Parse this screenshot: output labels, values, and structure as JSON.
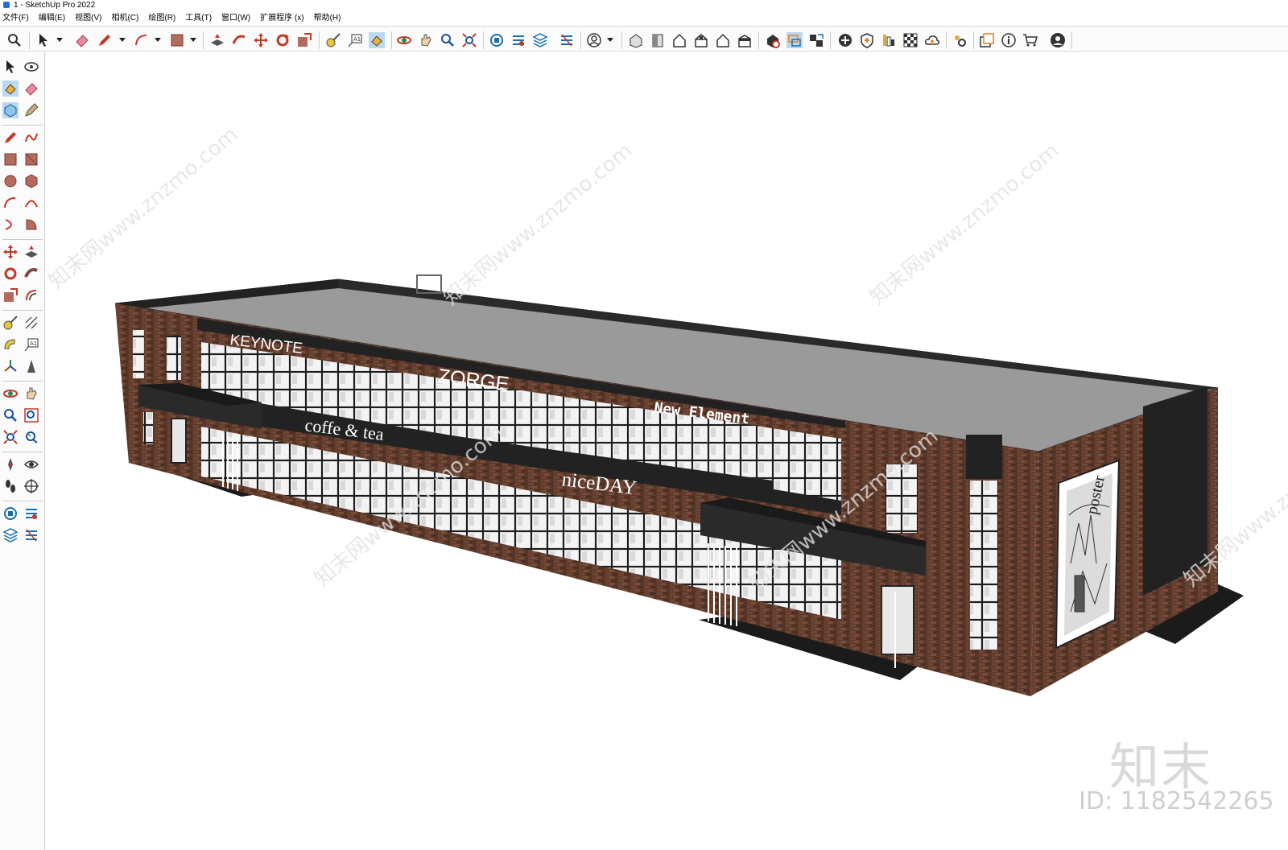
{
  "window": {
    "title": "1 - SketchUp Pro 2022"
  },
  "menu": {
    "items": [
      "文件(F)",
      "编辑(E)",
      "视图(V)",
      "相机(C)",
      "绘图(R)",
      "工具(T)",
      "窗口(W)",
      "扩展程序 (x)",
      "帮助(H)"
    ]
  },
  "toolbar": {
    "icons": [
      "search-icon",
      "select-icon",
      "eraser-icon",
      "pencil-icon",
      "arc-icon",
      "rectangle-icon",
      "push-pull-icon",
      "follow-me-icon",
      "move-icon",
      "rotate-icon",
      "scale-icon",
      "tape-measure-icon",
      "text-icon",
      "paint-bucket-icon",
      "orbit-icon",
      "pan-icon",
      "zoom-icon",
      "zoom-extents-icon",
      "warehouse-icon",
      "extension-warehouse-icon",
      "layout-icon",
      "styles-icon",
      "user-icon",
      "iso-view-icon",
      "top-view-icon",
      "front-view-icon",
      "right-view-icon",
      "back-view-icon",
      "left-view-icon",
      "solid-tools-icon",
      "section-plane-icon",
      "scenes-icon",
      "add-location-icon",
      "sandbox-icon",
      "dynamic-components-icon",
      "checkerboard-icon",
      "cloud-icon",
      "settings-icon",
      "outliner-icon",
      "info-icon",
      "cart-icon",
      "account-icon"
    ]
  },
  "left_toolbar": {
    "icons": [
      "select-icon",
      "orbit-icon",
      "paint-bucket-icon",
      "eraser-icon",
      "component-icon",
      "tag-icon",
      "pencil-icon",
      "freehand-icon",
      "rectangle-icon",
      "rotated-rectangle-icon",
      "circle-icon",
      "polygon-icon",
      "arc-icon",
      "two-point-arc-icon",
      "three-point-arc-icon",
      "pie-icon",
      "move-icon",
      "push-pull-icon",
      "rotate-icon",
      "follow-me-icon",
      "scale-icon",
      "offset-icon",
      "tape-measure-icon",
      "dimension-icon",
      "protractor-icon",
      "text-icon",
      "axes-icon",
      "3d-text-icon",
      "orbit-icon",
      "pan-icon",
      "zoom-icon",
      "zoom-window-icon",
      "zoom-extents-icon",
      "previous-view-icon",
      "position-camera-icon",
      "look-around-icon",
      "walk-icon",
      "section-plane-icon",
      "warehouse-icon",
      "extension-icon",
      "layout-icon",
      "styles-icon"
    ]
  },
  "model": {
    "signs": {
      "keynote": "KEYNOTE",
      "zorge": "ZORGE",
      "new_element": "New Element",
      "coffe_tea": "coffe & tea",
      "niceday": "niceDAY",
      "poster": "poster"
    }
  },
  "watermark": {
    "repeating_text": "知末网www.znzmo.com",
    "logo_text": "知末",
    "id_text": "ID: 1182542265"
  }
}
